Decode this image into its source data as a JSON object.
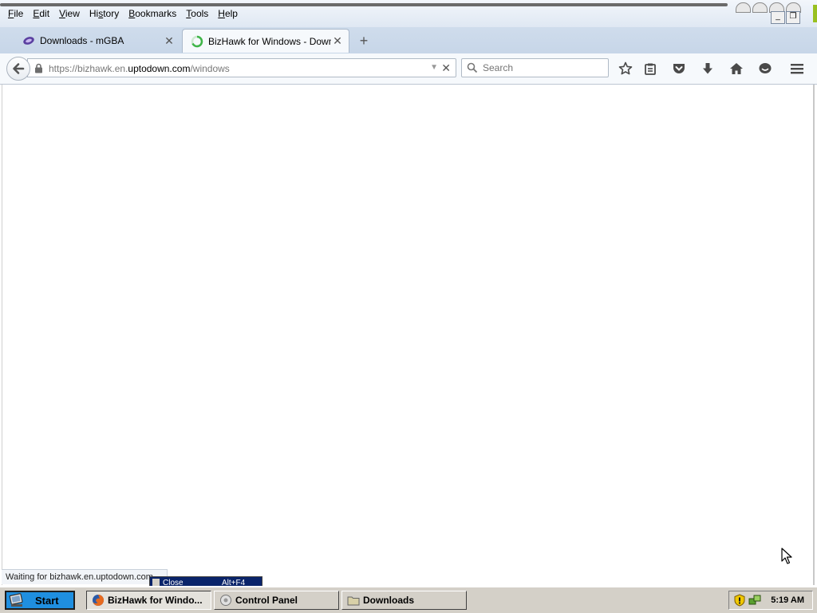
{
  "menu": {
    "items": [
      {
        "u": "F",
        "rest": "ile"
      },
      {
        "u": "E",
        "rest": "dit"
      },
      {
        "u": "V",
        "rest": "iew"
      },
      {
        "pre": "Hi",
        "u": "s",
        "rest": "tory"
      },
      {
        "u": "B",
        "rest": "ookmarks"
      },
      {
        "u": "T",
        "rest": "ools"
      },
      {
        "u": "H",
        "rest": "elp"
      }
    ]
  },
  "tabs": [
    {
      "label": "Downloads - mGBA",
      "icon": "mgba-icon",
      "active": false
    },
    {
      "label": "BizHawk for Windows - Downl...",
      "icon": "loading-spinner-icon",
      "active": true
    }
  ],
  "navbar": {
    "url_prefix": "https://bizhawk.en.",
    "url_domain": "uptodown.com",
    "url_path": "/windows",
    "search_placeholder": "Search"
  },
  "status": {
    "text": "Waiting for bizhawk.en.uptodown.com..."
  },
  "popup": {
    "label": "Close",
    "shortcut": "Alt+F4"
  },
  "taskbar": {
    "start_label": "Start",
    "buttons": [
      {
        "label": "BizHawk for Windo...",
        "icon": "firefox-icon"
      },
      {
        "label": "Control Panel",
        "icon": "control-panel-icon"
      },
      {
        "label": "Downloads",
        "icon": "folder-icon"
      }
    ],
    "clock": "5:19 AM"
  },
  "colors": {
    "accent": "#1f8fe0",
    "spinner": "#3fb548"
  }
}
